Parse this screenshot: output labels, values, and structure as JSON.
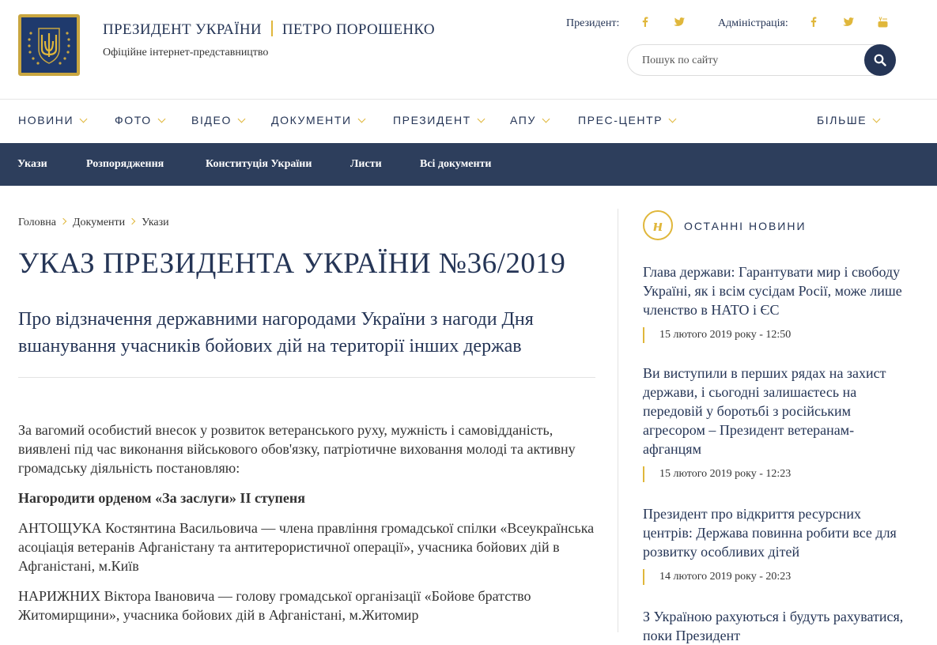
{
  "header": {
    "title": "ПРЕЗИДЕНТ УКРАЇНИ",
    "name": "ПЕТРО ПОРОШЕНКО",
    "subtitle": "Офіційне інтернет-представництво",
    "president_label": "Президент:",
    "admin_label": "Адміністрація:",
    "search_placeholder": "Пошук по сайту",
    "accent_color": "#e0b73b",
    "brand_color": "#253556"
  },
  "main_nav": {
    "items": [
      "НОВИНИ",
      "ФОТО",
      "ВІДЕО",
      "ДОКУМЕНТИ",
      "ПРЕЗИДЕНТ",
      "АПУ",
      "ПРЕС-ЦЕНТР"
    ],
    "more": "БІЛЬШЕ"
  },
  "sub_nav": {
    "items": [
      "Укази",
      "Розпорядження",
      "Конституція України",
      "Листи",
      "Всі документи"
    ]
  },
  "breadcrumb": [
    "Головна",
    "Документи",
    "Укази"
  ],
  "page": {
    "title": "УКАЗ ПРЕЗИДЕНТА УКРАЇНИ №36/2019",
    "lead": "Про відзначення державними нагородами України з нагоди Дня вшанування учасників бойових дій на території інших держав",
    "intro": "За вагомий особистий внесок у розвиток ветеранського руху, мужність і самовідданість, виявлені під час виконання військового обов'язку, патріотичне виховання молоді та активну громадську діяльність постановляю:",
    "award": "Нагородити орденом «За заслуги» II ступеня",
    "persons": [
      "АНТОЩУКА Костянтина Васильовича — члена правління громадської спілки «Всеукраїнська асоціація ветеранів Афганістану та антитерористичної операції», учасника бойових дій в Афганістані, м.Київ",
      "НАРИЖНИХ Віктора Івановича — голову громадської організації «Бойове братство Житомирщини», учасника бойових дій в Афганістані, м.Житомир"
    ]
  },
  "sidebar": {
    "icon_letter": "н",
    "heading": "ОСТАННІ НОВИНИ",
    "news": [
      {
        "title": "Глава держави: Гарантувати мир і свободу Україні, як і всім сусідам Росії, може лише членство в НАТО і ЄС",
        "date": "15 лютого 2019 року - 12:50"
      },
      {
        "title": "Ви виступили в перших рядах на захист держави, і сьогодні залишаєтесь на передовій у боротьбі з російським агресором – Президент ветеранам-афганцям",
        "date": "15 лютого 2019 року - 12:23"
      },
      {
        "title": "Президент про відкриття ресурсних центрів: Держава повинна робити все для розвитку особливих дітей",
        "date": "14 лютого 2019 року - 20:23"
      },
      {
        "title": "З Україною рахуються і будуть рахуватися, поки Президент",
        "date": ""
      }
    ]
  }
}
